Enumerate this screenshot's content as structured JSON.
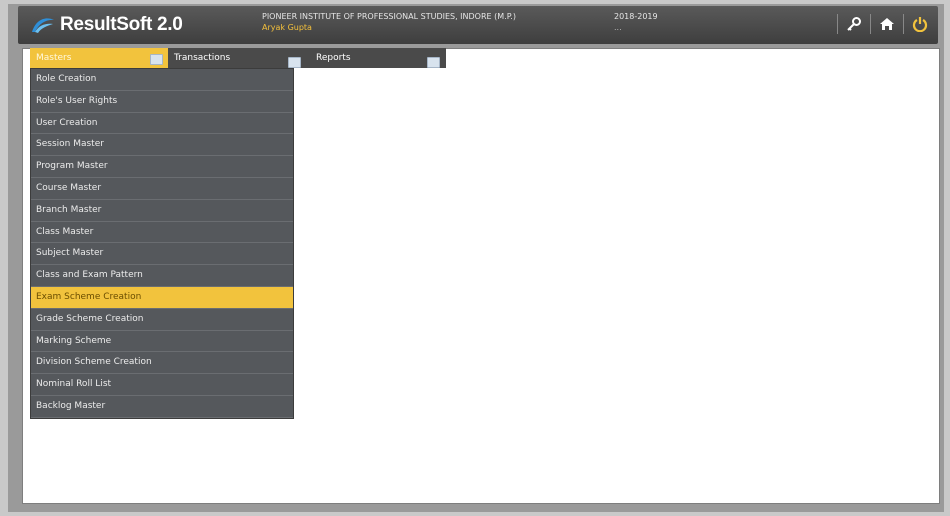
{
  "app": {
    "title": "ResultSoft 2.0"
  },
  "header": {
    "institute": "PIONEER INSTITUTE OF PROFESSIONAL STUDIES, INDORE (M.P.)",
    "user": "Aryak Gupta",
    "session": "2018-2019",
    "session_sub": "..."
  },
  "icons": {
    "tools": "key-icon",
    "home": "home-icon",
    "logout": "power-icon"
  },
  "colors": {
    "accent": "#f2c33d",
    "header": "#4a4a4a",
    "menu": "#55585c"
  },
  "menu": {
    "masters": "Masters",
    "transactions": "Transactions",
    "reports": "Reports"
  },
  "dropdown": {
    "selected_index": 10,
    "items": [
      "Role Creation",
      "Role's User Rights",
      "User Creation",
      "Session Master",
      "Program Master",
      "Course Master",
      "Branch Master",
      "Class Master",
      "Subject Master",
      "Class and Exam Pattern",
      "Exam Scheme Creation",
      "Grade Scheme Creation",
      "Marking Scheme",
      "Division Scheme Creation",
      "Nominal Roll List",
      "Backlog Master"
    ]
  }
}
